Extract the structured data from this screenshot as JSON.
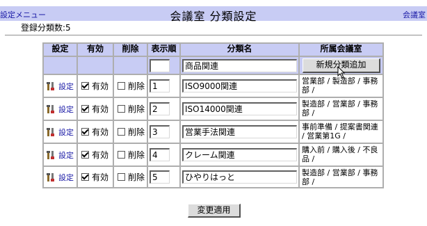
{
  "header": {
    "menu_link": "設定メニュー",
    "title": "会議室 分類設定",
    "right_link": "会議室"
  },
  "count_text": "登録分類数:5",
  "table": {
    "columns": [
      "設定",
      "有効",
      "削除",
      "表示順",
      "分類名",
      "所属会議室"
    ],
    "new_row": {
      "order": "",
      "name": "商品関連",
      "add_button": "新規分類追加"
    },
    "rows": [
      {
        "settings_label": "設定",
        "enabled_label": "有効",
        "enabled": true,
        "delete_label": "削除",
        "delete": false,
        "order": "1",
        "name": "ISO9000関連",
        "rooms": "営業部 / 製造部 / 事務部 /"
      },
      {
        "settings_label": "設定",
        "enabled_label": "有効",
        "enabled": true,
        "delete_label": "削除",
        "delete": false,
        "order": "2",
        "name": "ISO14000関連",
        "rooms": "製造部 / 営業部 / 事務部 /"
      },
      {
        "settings_label": "設定",
        "enabled_label": "有効",
        "enabled": true,
        "delete_label": "削除",
        "delete": false,
        "order": "3",
        "name": "営業手法関連",
        "rooms": "事前準備 / 提案書関連 / 営業第1G /"
      },
      {
        "settings_label": "設定",
        "enabled_label": "有効",
        "enabled": true,
        "delete_label": "削除",
        "delete": false,
        "order": "4",
        "name": "クレーム関連",
        "rooms": "購入前 / 購入後 / 不良品 /"
      },
      {
        "settings_label": "設定",
        "enabled_label": "有効",
        "enabled": true,
        "delete_label": "削除",
        "delete": false,
        "order": "5",
        "name": "ひやりはっと",
        "rooms": "製造部 / 営業部 / 事務部 /"
      }
    ]
  },
  "apply_button": "変更適用"
}
